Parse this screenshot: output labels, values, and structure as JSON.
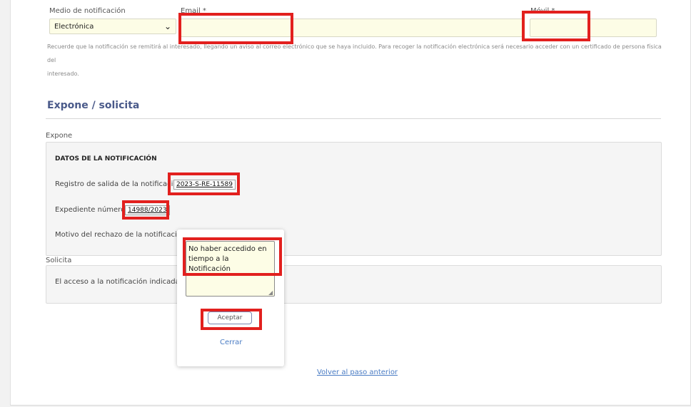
{
  "notification": {
    "medio_label": "Medio de notificación",
    "medio_value": "Electrónica",
    "email_label": "Email *",
    "email_value": "",
    "movil_label": "Móvil *",
    "movil_value": "",
    "hint_line1": "Recuerde que la notificación se remitirá al interesado, llegando un aviso al correo electrónico que se haya incluido. Para recoger la notificación electrónica será necesario acceder con un certificado de persona física del",
    "hint_line2": "interesado."
  },
  "expone_section": {
    "title": "Expone / solicita",
    "expone_label": "Expone",
    "panel_heading": "DATOS DE LA NOTIFICACIÓN",
    "registro_label": "Registro de salida de la notificación:",
    "registro_value": "2023-S-RE-11589",
    "expediente_label": "Expediente número:",
    "expediente_value": "14988/2023",
    "motivo_label": "Motivo del rechazo de la notificación:",
    "solicita_label": "Solicita",
    "solicita_text": "El acceso a la notificación indicada."
  },
  "popover": {
    "textarea_value": "No haber accedido en tiempo a la Notificación",
    "accept_label": "Aceptar",
    "close_label": "Cerrar"
  },
  "footer": {
    "back_link": "Volver al paso anterior"
  },
  "colors": {
    "highlight": "#e2201e",
    "field_bg": "#fdfde6",
    "section_title": "#4a5a8a",
    "link": "#4a7cc4"
  }
}
